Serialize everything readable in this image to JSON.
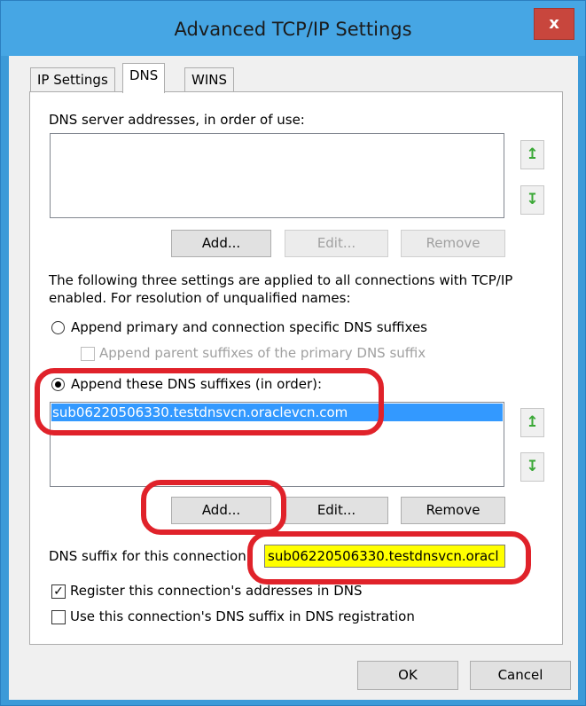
{
  "window": {
    "title": "Advanced TCP/IP Settings",
    "close_glyph": "x"
  },
  "tabs": [
    {
      "label": "IP Settings"
    },
    {
      "label": "DNS"
    },
    {
      "label": "WINS"
    }
  ],
  "dns": {
    "servers_label": "DNS server addresses, in order of use:",
    "servers_buttons": {
      "add": "Add...",
      "edit": "Edit...",
      "remove": "Remove"
    },
    "info_line1": "The following three settings are applied to all connections with TCP/IP",
    "info_line2": "enabled. For resolution of unqualified names:",
    "radio_primary": "Append primary and connection specific DNS suffixes",
    "check_parent": "Append parent suffixes of the primary DNS suffix",
    "radio_these": "Append these DNS suffixes (in order):",
    "suffix_items": [
      "sub06220506330.testdnsvcn.oraclevcn.com"
    ],
    "suffix_buttons": {
      "add": "Add...",
      "edit": "Edit...",
      "remove": "Remove"
    },
    "connection_suffix_label": "DNS suffix for this connection:",
    "connection_suffix_value": "sub06220506330.testdnsvcn.oracl",
    "register_label": "Register this connection's addresses in DNS",
    "use_suffix_label": "Use this connection's DNS suffix in DNS registration"
  },
  "footer": {
    "ok": "OK",
    "cancel": "Cancel"
  },
  "icons": {
    "up": "arrow-up-icon",
    "down": "arrow-down-icon"
  },
  "colors": {
    "highlight": "#e0222a",
    "selection": "#3399ff",
    "text_highlight": "#ffff00"
  }
}
